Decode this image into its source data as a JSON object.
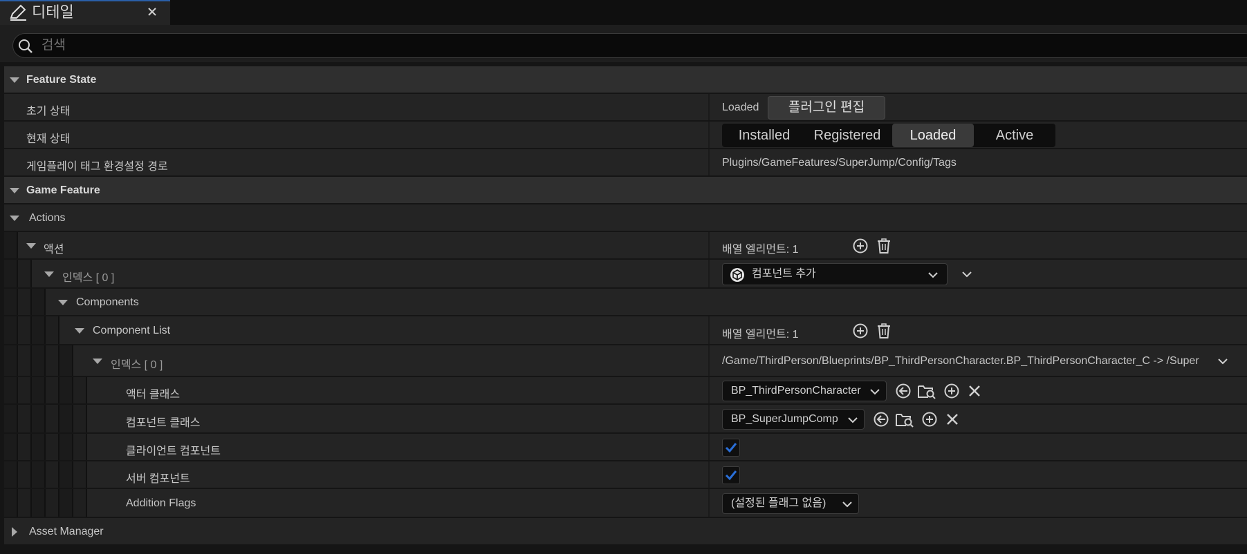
{
  "tab": {
    "title": "디테일"
  },
  "search": {
    "placeholder": "검색"
  },
  "feature_state": {
    "header": "Feature State",
    "initial_state_label": "초기 상태",
    "initial_state_value": "Loaded",
    "edit_plugin_button": "플러그인 편집",
    "current_state_label": "현재 상태",
    "states": [
      "Installed",
      "Registered",
      "Loaded",
      "Active"
    ],
    "active_state": "Loaded",
    "tag_config_label": "게임플레이 태그 환경설정 경로",
    "tag_config_value": "Plugins/GameFeatures/SuperJump/Config/Tags"
  },
  "game_feature": {
    "header": "Game Feature",
    "actions_header": "Actions",
    "actions_label": "액션",
    "array_elements_1": "배열 엘리먼트: 1",
    "index0_label": "인덱스 [ 0 ]",
    "add_component_combo": "컴포넌트 추가",
    "components_label": "Components",
    "component_list_label": "Component List",
    "array_elements_2": "배열 엘리먼트: 1",
    "index0b_label": "인덱스 [ 0 ]",
    "index0b_value": "/Game/ThirdPerson/Blueprints/BP_ThirdPersonCharacter.BP_ThirdPersonCharacter_C -> /Super",
    "actor_class_label": "액터 클래스",
    "actor_class_value": "BP_ThirdPersonCharacter",
    "component_class_label": "컴포넌트 클래스",
    "component_class_value": "BP_SuperJumpComp",
    "client_component_label": "클라이언트 컴포넌트",
    "client_component_checked": true,
    "server_component_label": "서버 컴포넌트",
    "server_component_checked": true,
    "addition_flags_label": "Addition Flags",
    "addition_flags_value": "(설정된 플래그 없음)"
  },
  "asset_manager": {
    "header": "Asset Manager"
  },
  "colors": {
    "accent": "#2a5fa8",
    "check": "#2a6fd8"
  }
}
